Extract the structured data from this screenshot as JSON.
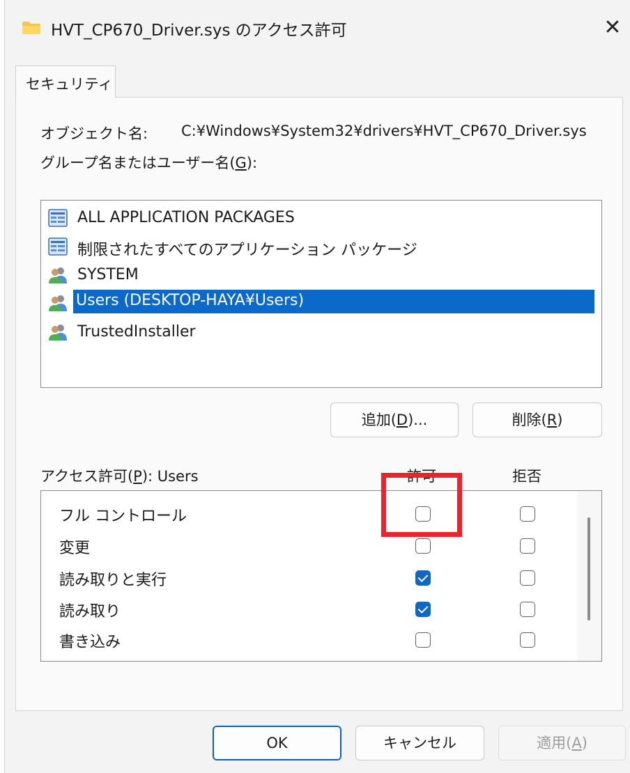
{
  "window": {
    "title": "HVT_CP670_Driver.sys のアクセス許可",
    "close_glyph": "✕"
  },
  "tabs": [
    {
      "label": "セキュリティ"
    }
  ],
  "object": {
    "label": "オブジェクト名:",
    "value": "C:¥Windows¥System32¥drivers¥HVT_CP670_Driver.sys"
  },
  "groups_label": {
    "text": "グループ名またはユーザー名(",
    "key": "G",
    "suffix": "):"
  },
  "users": [
    {
      "name": "ALL APPLICATION PACKAGES",
      "icon": "package-group-icon",
      "selected": false
    },
    {
      "name": "制限されたすべてのアプリケーション パッケージ",
      "icon": "package-group-icon",
      "selected": false
    },
    {
      "name": "SYSTEM",
      "icon": "users-icon",
      "selected": false
    },
    {
      "name": "Users (DESKTOP-HAYA¥Users)",
      "icon": "users-icon",
      "selected": true
    },
    {
      "name": "TrustedInstaller",
      "icon": "users-icon",
      "selected": false
    }
  ],
  "buttons": {
    "add": {
      "text": "追加(",
      "key": "D",
      "suffix": ")..."
    },
    "remove": {
      "text": "削除(",
      "key": "R",
      "suffix": ")"
    },
    "ok": "OK",
    "cancel": "キャンセル",
    "apply": {
      "text": "適用(",
      "key": "A",
      "suffix": ")"
    }
  },
  "permissions": {
    "label_text": "アクセス許可(",
    "label_key": "P",
    "label_suffix": "): Users",
    "allow_header": "許可",
    "deny_header": "拒否",
    "rows": [
      {
        "name": "フル コントロール",
        "allow": false,
        "deny": false
      },
      {
        "name": "変更",
        "allow": false,
        "deny": false
      },
      {
        "name": "読み取りと実行",
        "allow": true,
        "deny": false
      },
      {
        "name": "読み取り",
        "allow": true,
        "deny": false
      },
      {
        "name": "書き込み",
        "allow": false,
        "deny": false
      }
    ]
  },
  "colors": {
    "selection": "#0a69c9",
    "checkbox_checked": "#0f67c4",
    "highlight_annotation": "#e8242e"
  }
}
